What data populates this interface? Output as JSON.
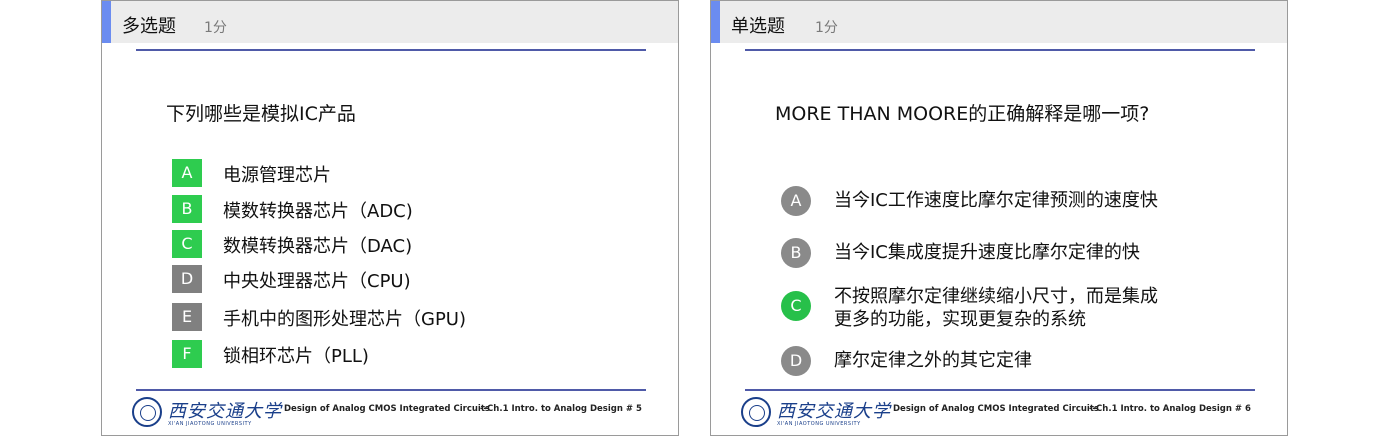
{
  "slides": [
    {
      "header": {
        "type": "多选题",
        "score": "1分"
      },
      "question": "下列哪些是模拟IC产品",
      "options": [
        {
          "letter": "A",
          "text": "电源管理芯片",
          "state": "green"
        },
        {
          "letter": "B",
          "text": "模数转换器芯片（ADC)",
          "state": "green"
        },
        {
          "letter": "C",
          "text": "数模转换器芯片（DAC)",
          "state": "green"
        },
        {
          "letter": "D",
          "text": "中央处理器芯片（CPU)",
          "state": "gray"
        },
        {
          "letter": "E",
          "text": "手机中的图形处理芯片（GPU)",
          "state": "gray"
        },
        {
          "letter": "F",
          "text": "锁相环芯片（PLL)",
          "state": "green"
        }
      ],
      "footer": {
        "logo_cn": "西安交通大学",
        "logo_en": "XI'AN JIAOTONG UNIVERSITY",
        "course": "Design of Analog CMOS Integrated Circuits",
        "page": "--Ch.1  Intro. to Analog Design  # 5"
      }
    },
    {
      "header": {
        "type": "单选题",
        "score": "1分"
      },
      "question": "MORE THAN MOORE的正确解释是哪一项?",
      "options": [
        {
          "letter": "A",
          "lines": [
            "当今IC工作速度比摩尔定律预测的速度快"
          ],
          "state": "gray"
        },
        {
          "letter": "B",
          "lines": [
            "当今IC集成度提升速度比摩尔定律的快"
          ],
          "state": "gray"
        },
        {
          "letter": "C",
          "lines": [
            "不按照摩尔定律继续缩小尺寸，而是集成",
            "更多的功能，实现更复杂的系统"
          ],
          "state": "green"
        },
        {
          "letter": "D",
          "lines": [
            "摩尔定律之外的其它定律"
          ],
          "state": "gray"
        }
      ],
      "footer": {
        "logo_cn": "西安交通大学",
        "logo_en": "XI'AN JIAOTONG UNIVERSITY",
        "course": "Design of Analog CMOS Integrated Circuits",
        "page": "--Ch.1  Intro. to Analog Design  # 6"
      }
    }
  ],
  "colors": {
    "accent": "#6b8cf0",
    "rule": "#4f5aa8",
    "correct": "#2ecc4f",
    "neutral": "#808080",
    "logo": "#1a3f8a"
  }
}
